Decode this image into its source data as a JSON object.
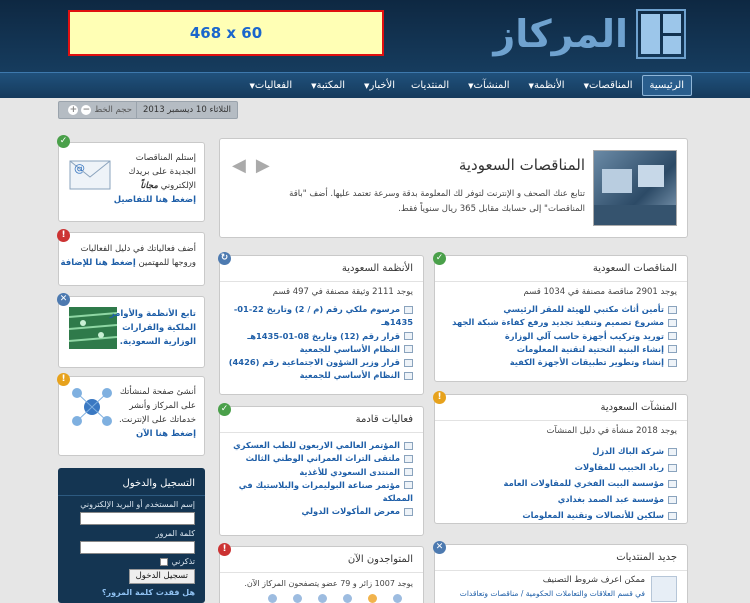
{
  "header": {
    "ad_text": "468 x 60",
    "logo_text": "المركاز"
  },
  "nav": {
    "items": [
      {
        "label": "الرئيسية",
        "caret": false,
        "active": true
      },
      {
        "label": "المناقصات",
        "caret": true
      },
      {
        "label": "الأنظمة",
        "caret": true
      },
      {
        "label": "المنشآت",
        "caret": true
      },
      {
        "label": "المنتديات",
        "caret": false
      },
      {
        "label": "الأخبار",
        "caret": true
      },
      {
        "label": "المكتبة",
        "caret": true
      },
      {
        "label": "الفعاليات",
        "caret": true
      }
    ]
  },
  "dateline": {
    "date": "الثلاثاء 10 ديسمبر 2013",
    "font_size_label": "حجم الخط",
    "minus": "−",
    "plus": "+"
  },
  "sidebar": {
    "email_box": {
      "line1": "إستلم المناقصات",
      "line2": "الجديدة على بريدك",
      "line3": "الإلكتروني",
      "free": "مجاناً",
      "link": "إضغط هنا للتفاصيل"
    },
    "events_box": {
      "line1": "أضف فعالياتك في دليل الفعاليات",
      "line2": "وروجها للمهتمين",
      "link": "إضغط هنا للإضافة"
    },
    "laws_box": {
      "line1": "تابع الأنظمة والأوامر",
      "line2": "الملكية والقرارات",
      "line3": "الوزارية السعودية."
    },
    "company_box": {
      "line1": "أنشئ صفحة لمنشأتك",
      "line2": "على المركاز وأنشر",
      "line3": "خدماتك على الإنترنت.",
      "link": "إضغط هنا الآن"
    },
    "login": {
      "title": "التسجيل والدخول",
      "username_label": "إسم المستخدم أو البريد الإلكتروني",
      "password_label": "كلمة المرور",
      "remember_label": "تذكرني",
      "login_button": "تسجيل الدخول",
      "forgot_link": "هل فقدت كلمة المرور؟"
    }
  },
  "featured": {
    "title": "المناقصات السعودية",
    "desc": "تتابع عنك الصحف و الإنترنت لتوفر لك المعلومة بدقة وسرعة تعتمد عليها. أضف \"باقة المناقصات\" إلى حسابك مقابل 365 ريال سنوياً فقط.",
    "prev": "◀",
    "next": "▶"
  },
  "panels": {
    "tenders": {
      "title": "المناقصات السعودية",
      "sub": "يوجد 2901 مناقصة مصنفة في 1034 قسم",
      "items": [
        "تأمين أثاث مكتبي للهيئة للمقر الرئيسي",
        "مشروع تصميم وتنفيذ تجديد ورفع كفاءة شبكة الجهد",
        "توريد وتركيب أجهزة حاسب آلي الوزارة",
        "إنشاء البنية التحتية لتقنية المعلومات",
        "إنشاء وتطوير تطبيقات الأجهزة الكفية"
      ]
    },
    "laws": {
      "title": "الأنظمة السعودية",
      "sub": "يوجد 2111 وثيقة مصنفة في 497 قسم",
      "items": [
        "مرسوم ملكي رقم (م / 2) وتاريخ 22-01-1435هـ",
        "قرار رقم (12) وتاريخ 08-01-1435هـ",
        "النظام الأساسي للجمعية",
        "قرار وزير الشؤون الاجتماعية رقم (4426)",
        "النظام الأساسي للجمعية"
      ]
    },
    "companies": {
      "title": "المنشآت السعودية",
      "sub": "يوجد 2018 منشأة في دليل المنشآت",
      "items": [
        "شركة الباك الدزل",
        "رياد الحبيب للمقاولات",
        "مؤسسة البيت الفخري للمقاولات العامة",
        "مؤسسة عبد الصمد بغدادي",
        "سلكين للأتصالات وتقنية المعلومات"
      ]
    },
    "events": {
      "title": "فعاليات قادمة",
      "items": [
        "المؤتمر العالمي الاربعون للطب العسكري",
        "ملتقى التراث العمراني الوطني الثالث",
        "المنتدى السعودي للأغذية",
        "مؤتمر صناعة البوليمرات والبلاستيك في المملكة",
        "معرض المأكولات الدولي"
      ]
    },
    "online": {
      "title": "المتواجدون الآن",
      "sub": "يوجد 1007 زائر و 79 عضو يتصفحون المركاز الآن."
    },
    "forums": {
      "title": "جديد المنتديات",
      "post_title": "ممكن اعرف شروط التصنيف",
      "post_meta": "في قسم العلاقات والتعاملات الحكومية / مناقصات وتعاقدات"
    }
  }
}
